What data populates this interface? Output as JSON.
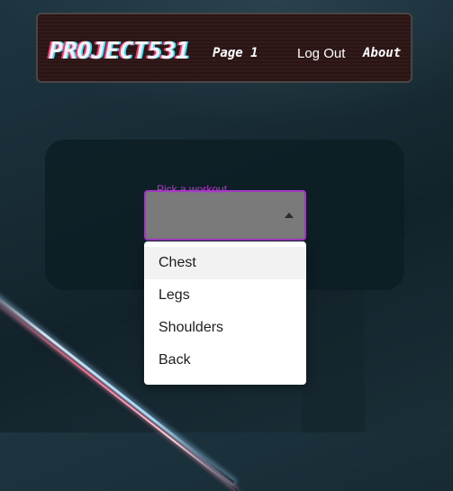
{
  "navbar": {
    "logo": "PROJECT531",
    "page": "Page 1",
    "logout": "Log Out",
    "about": "About"
  },
  "select": {
    "label": "Pick a workout",
    "value": "",
    "options": [
      "Chest",
      "Legs",
      "Shoulders",
      "Back"
    ],
    "highlighted": "Chest"
  },
  "icons": {
    "dropdown": "caret-up-icon"
  },
  "colors": {
    "accent": "#a236c2",
    "navbar_bg": "#2a1414"
  }
}
